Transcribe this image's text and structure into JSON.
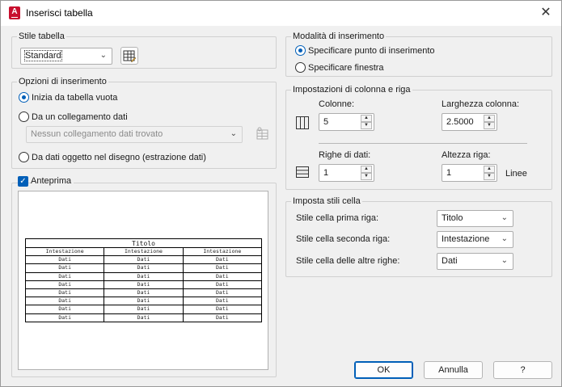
{
  "window": {
    "title": "Inserisci tabella",
    "app_icon_letter": "A",
    "close_glyph": "✕"
  },
  "table_style": {
    "group_label": "Stile tabella",
    "selected": "Standard"
  },
  "insert_options": {
    "group_label": "Opzioni di inserimento",
    "empty_table": "Inizia da tabella vuota",
    "data_link": "Da un collegamento dati",
    "data_link_combo": "Nessun collegamento dati trovato",
    "object_data": "Da dati oggetto nel disegno (estrazione dati)"
  },
  "preview": {
    "label": "Anteprima",
    "checked": true,
    "table_title": "Titolo",
    "headers": [
      "Intestazione",
      "Intestazione",
      "Intestazione"
    ],
    "rows": [
      [
        "Dati",
        "Dati",
        "Dati"
      ],
      [
        "Dati",
        "Dati",
        "Dati"
      ],
      [
        "Dati",
        "Dati",
        "Dati"
      ],
      [
        "Dati",
        "Dati",
        "Dati"
      ],
      [
        "Dati",
        "Dati",
        "Dati"
      ],
      [
        "Dati",
        "Dati",
        "Dati"
      ],
      [
        "Dati",
        "Dati",
        "Dati"
      ],
      [
        "Dati",
        "Dati",
        "Dati"
      ]
    ]
  },
  "insert_mode": {
    "group_label": "Modalità di inserimento",
    "insertion_point": "Specificare punto di inserimento",
    "window": "Specificare finestra"
  },
  "col_row": {
    "group_label": "Impostazioni di colonna e riga",
    "columns_label": "Colonne:",
    "columns_value": "5",
    "col_width_label": "Larghezza colonna:",
    "col_width_value": "2.5000",
    "data_rows_label": "Righe di dati:",
    "data_rows_value": "1",
    "row_height_label": "Altezza riga:",
    "row_height_value": "1",
    "row_height_unit": "Linee"
  },
  "cell_styles": {
    "group_label": "Imposta stili cella",
    "first_row_label": "Stile cella prima riga:",
    "first_row_value": "Titolo",
    "second_row_label": "Stile cella seconda riga:",
    "second_row_value": "Intestazione",
    "other_rows_label": "Stile cella delle altre righe:",
    "other_rows_value": "Dati"
  },
  "buttons": {
    "ok": "OK",
    "cancel": "Annulla",
    "help": "?"
  },
  "colors": {
    "accent": "#005fb8",
    "brand": "#c8102e"
  }
}
